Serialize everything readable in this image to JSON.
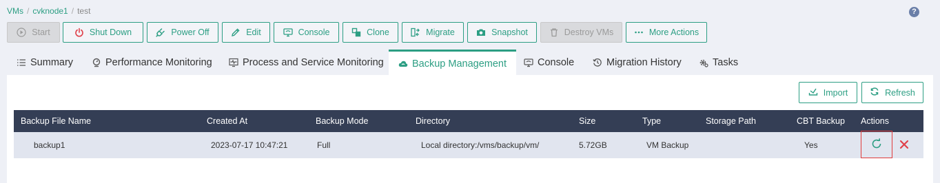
{
  "breadcrumb": {
    "items": [
      "VMs",
      "cvknode1",
      "test"
    ]
  },
  "help": {
    "glyph": "?"
  },
  "toolbar": {
    "start": "Start",
    "shutdown": "Shut Down",
    "poweroff": "Power Off",
    "edit": "Edit",
    "console": "Console",
    "clone": "Clone",
    "migrate": "Migrate",
    "snapshot": "Snapshot",
    "destroy": "Destroy VMs",
    "more": "More Actions"
  },
  "tabs": {
    "summary": "Summary",
    "performance": "Performance Monitoring",
    "process": "Process and Service Monitoring",
    "backup": "Backup Management",
    "console": "Console",
    "migration": "Migration History",
    "tasks": "Tasks"
  },
  "panel": {
    "import": "Import",
    "refresh": "Refresh"
  },
  "table": {
    "headers": [
      "Backup File Name",
      "Created At",
      "Backup Mode",
      "Directory",
      "Size",
      "Type",
      "Storage Path",
      "CBT Backup",
      "Actions"
    ],
    "rows": [
      {
        "name": "backup1",
        "created": "2023-07-17 10:47:21",
        "mode": "Full",
        "directory": "Local directory:/vms/backup/vm/",
        "size": "5.72GB",
        "type": "VM Backup",
        "storage": "",
        "cbt": "Yes"
      }
    ]
  },
  "colors": {
    "accent": "#2c9e83",
    "header_bg": "#343e55",
    "danger": "#e0404a"
  }
}
